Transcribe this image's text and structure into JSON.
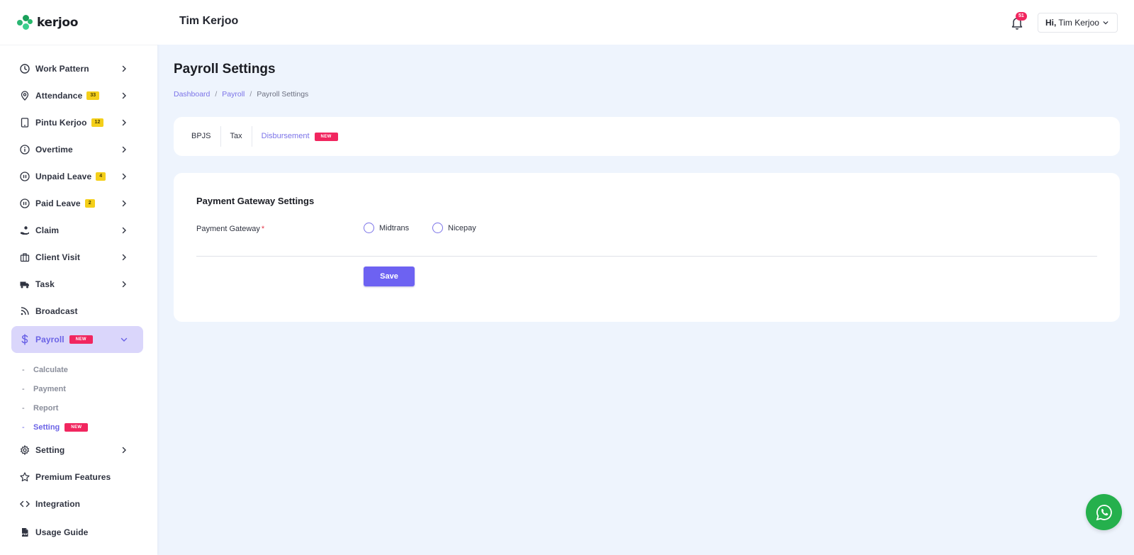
{
  "brand": {
    "name": "kerjoo"
  },
  "header": {
    "title": "Tim Kerjoo",
    "notifications_count": "51",
    "greeting": "Hi,",
    "user_name": "Tim Kerjoo"
  },
  "sidebar": {
    "items": [
      {
        "label": "Work Pattern",
        "icon": "clock-icon"
      },
      {
        "label": "Attendance",
        "icon": "location-pin-icon",
        "badge": "33"
      },
      {
        "label": "Pintu Kerjoo",
        "icon": "tablet-icon",
        "badge": "12"
      },
      {
        "label": "Overtime",
        "icon": "info-icon"
      },
      {
        "label": "Unpaid Leave",
        "icon": "pause-circle-icon",
        "badge": "4"
      },
      {
        "label": "Paid Leave",
        "icon": "pause-circle-icon",
        "badge": "2"
      },
      {
        "label": "Claim",
        "icon": "hand-coin-icon"
      },
      {
        "label": "Client Visit",
        "icon": "briefcase-icon"
      },
      {
        "label": "Task",
        "icon": "truck-icon"
      },
      {
        "label": "Broadcast",
        "icon": "rss-icon"
      },
      {
        "label": "Payroll",
        "icon": "dollar-icon",
        "badge": "NEW"
      },
      {
        "label": "Setting",
        "icon": "gear-icon"
      },
      {
        "label": "Premium Features",
        "icon": "star-icon"
      },
      {
        "label": "Integration",
        "icon": "code-icon"
      },
      {
        "label": "Usage Guide",
        "icon": "pdf-file-icon"
      }
    ],
    "payroll_sub": [
      {
        "label": "Calculate"
      },
      {
        "label": "Payment"
      },
      {
        "label": "Report"
      },
      {
        "label": "Setting",
        "badge": "NEW"
      }
    ]
  },
  "page": {
    "title": "Payroll Settings",
    "breadcrumb": [
      "Dashboard",
      "Payroll",
      "Payroll Settings"
    ],
    "breadcrumb_sep": "/"
  },
  "tabs": [
    {
      "label": "BPJS"
    },
    {
      "label": "Tax"
    },
    {
      "label": "Disbursement",
      "badge": "NEW"
    }
  ],
  "form": {
    "section_title": "Payment Gateway Settings",
    "field_label": "Payment Gateway",
    "required_mark": "*",
    "options": [
      "Midtrans",
      "Nicepay"
    ],
    "selected": null,
    "save_label": "Save"
  },
  "colors": {
    "accent": "#6d62f2",
    "new_badge": "#f1265f",
    "count_badge": "#f4cf1a",
    "whatsapp": "#25b04d",
    "background": "#eef4fd"
  }
}
